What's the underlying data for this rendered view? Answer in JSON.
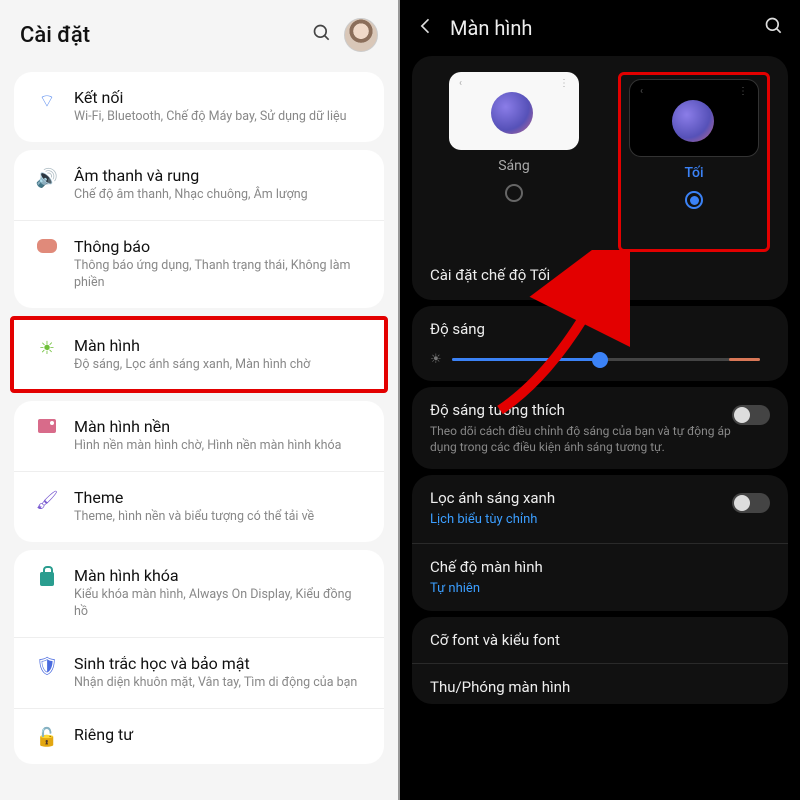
{
  "left": {
    "title": "Cài đặt",
    "items": {
      "connections": {
        "label": "Kết nối",
        "sub": "Wi-Fi, Bluetooth, Chế độ Máy bay, Sử dụng dữ liệu"
      },
      "sound": {
        "label": "Âm thanh và rung",
        "sub": "Chế độ âm thanh, Nhạc chuông, Âm lượng"
      },
      "notifications": {
        "label": "Thông báo",
        "sub": "Thông báo ứng dụng, Thanh trạng thái, Không làm phiền"
      },
      "display": {
        "label": "Màn hình",
        "sub": "Độ sáng, Lọc ánh sáng xanh, Màn hình chờ"
      },
      "wallpaper": {
        "label": "Màn hình nền",
        "sub": "Hình nền màn hình chờ, Hình nền màn hình khóa"
      },
      "theme": {
        "label": "Theme",
        "sub": "Theme, hình nền và biểu tượng có thể tải về"
      },
      "lock": {
        "label": "Màn hình khóa",
        "sub": "Kiểu khóa màn hình, Always On Display, Kiểu đồng hồ"
      },
      "biometrics": {
        "label": "Sinh trắc học và bảo mật",
        "sub": "Nhận diện khuôn mặt, Vân tay, Tìm di động của bạn"
      },
      "privacy": {
        "label": "Riêng tư"
      }
    }
  },
  "right": {
    "title": "Màn hình",
    "theme_light": "Sáng",
    "theme_dark": "Tối",
    "dark_settings": "Cài đặt chế độ Tối",
    "brightness": "Độ sáng",
    "adaptive": {
      "label": "Độ sáng tương thích",
      "sub": "Theo dõi cách điều chỉnh độ sáng của bạn và tự động áp dụng trong các điều kiện ánh sáng tương tự."
    },
    "bluelight": {
      "label": "Lọc ánh sáng xanh",
      "sub": "Lịch biểu tùy chỉnh"
    },
    "screenmode": {
      "label": "Chế độ màn hình",
      "sub": "Tự nhiên"
    },
    "fontsize": "Cỡ font và kiểu font",
    "zoom": "Thu/Phóng màn hình"
  }
}
